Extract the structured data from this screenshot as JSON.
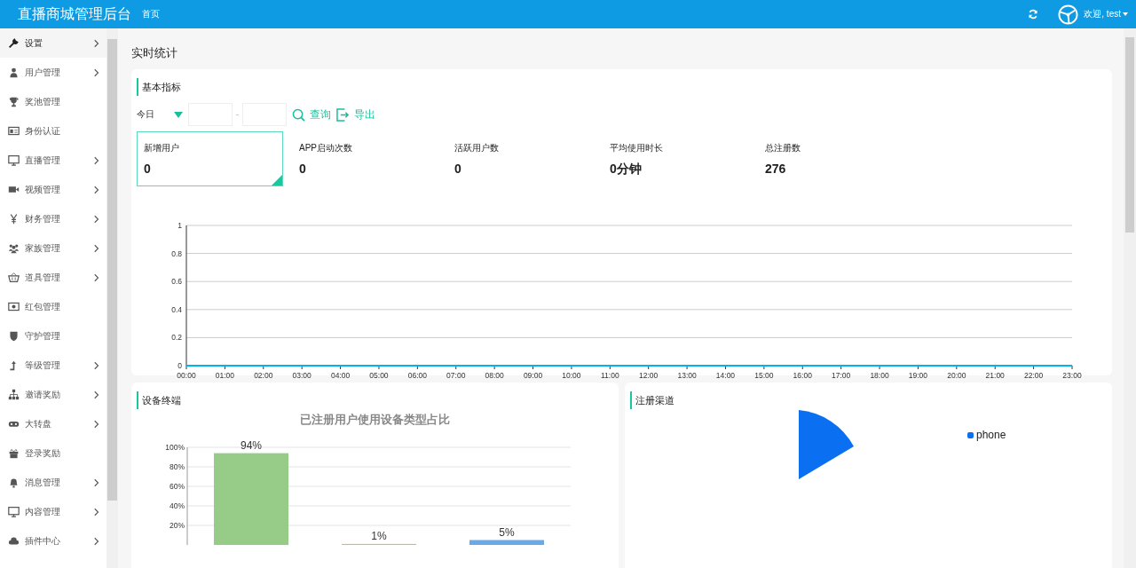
{
  "header": {
    "title": "直播商城管理后台",
    "nav": [
      {
        "label": "首页"
      }
    ],
    "user": {
      "greeting": "欢迎, test"
    }
  },
  "sidebar": {
    "items": [
      {
        "label": "设置",
        "expandable": true,
        "selected": true
      },
      {
        "label": "用户管理",
        "expandable": true,
        "selected": false
      },
      {
        "label": "奖池管理",
        "expandable": false,
        "selected": false
      },
      {
        "label": "身份认证",
        "expandable": false,
        "selected": false
      },
      {
        "label": "直播管理",
        "expandable": true,
        "selected": false
      },
      {
        "label": "视频管理",
        "expandable": true,
        "selected": false
      },
      {
        "label": "财务管理",
        "expandable": true,
        "selected": false
      },
      {
        "label": "家族管理",
        "expandable": true,
        "selected": false
      },
      {
        "label": "道具管理",
        "expandable": true,
        "selected": false
      },
      {
        "label": "红包管理",
        "expandable": false,
        "selected": false
      },
      {
        "label": "守护管理",
        "expandable": false,
        "selected": false
      },
      {
        "label": "等级管理",
        "expandable": true,
        "selected": false
      },
      {
        "label": "邀请奖励",
        "expandable": true,
        "selected": false
      },
      {
        "label": "大转盘",
        "expandable": true,
        "selected": false
      },
      {
        "label": "登录奖励",
        "expandable": false,
        "selected": false
      },
      {
        "label": "消息管理",
        "expandable": true,
        "selected": false
      },
      {
        "label": "内容管理",
        "expandable": true,
        "selected": false
      },
      {
        "label": "插件中心",
        "expandable": true,
        "selected": false
      }
    ]
  },
  "page": {
    "title": "实时统计"
  },
  "basic_metrics": {
    "title": "基本指标",
    "filter": {
      "period": "今日",
      "separator": "-",
      "buttons": [
        "查询",
        "导出"
      ]
    },
    "metrics": [
      {
        "label": "新增用户",
        "value": "0",
        "selected": true
      },
      {
        "label": "APP启动次数",
        "value": "0",
        "selected": false
      },
      {
        "label": "活跃用户数",
        "value": "0",
        "selected": false
      },
      {
        "label": "平均使用时长",
        "value": "0分钟",
        "selected": false
      },
      {
        "label": "总注册数",
        "value": "276",
        "selected": false
      }
    ],
    "chart_data": {
      "type": "line",
      "x": [
        "00:00",
        "01:00",
        "02:00",
        "03:00",
        "04:00",
        "05:00",
        "06:00",
        "07:00",
        "08:00",
        "09:00",
        "10:00",
        "11:00",
        "12:00",
        "13:00",
        "14:00",
        "15:00",
        "16:00",
        "17:00",
        "18:00",
        "19:00",
        "20:00",
        "21:00",
        "22:00",
        "23:00"
      ],
      "ylim": [
        0,
        1
      ],
      "yticks": [
        0,
        0.2,
        0.4,
        0.6,
        0.8,
        1
      ],
      "grid": true,
      "series": [
        {
          "color": "#00b4f0",
          "values": [
            0,
            0,
            0,
            0,
            0,
            0,
            0,
            0,
            0,
            0,
            0,
            0,
            0,
            0,
            0,
            0,
            0,
            0,
            0,
            0,
            0,
            0,
            0,
            0
          ]
        }
      ]
    }
  },
  "device_terminals": {
    "title": "设备终端",
    "chart_data": {
      "type": "bar",
      "title": "已注册用户使用设备类型占比",
      "values": [
        94,
        1,
        5
      ],
      "ylim": [
        0,
        100
      ],
      "grid": true,
      "yticks": [
        {
          "value": 20,
          "label": "20%"
        },
        {
          "value": 40,
          "label": "40%"
        },
        {
          "value": 60,
          "label": "60%"
        },
        {
          "value": 80,
          "label": "80%"
        },
        {
          "value": 100,
          "label": "100%"
        }
      ],
      "value_labels": [
        "94%",
        "1%",
        "5%"
      ]
    }
  },
  "registration_channels": {
    "title": "注册渠道",
    "legend": [
      {
        "label": "phone",
        "color": "#0a6ff0"
      }
    ]
  }
}
